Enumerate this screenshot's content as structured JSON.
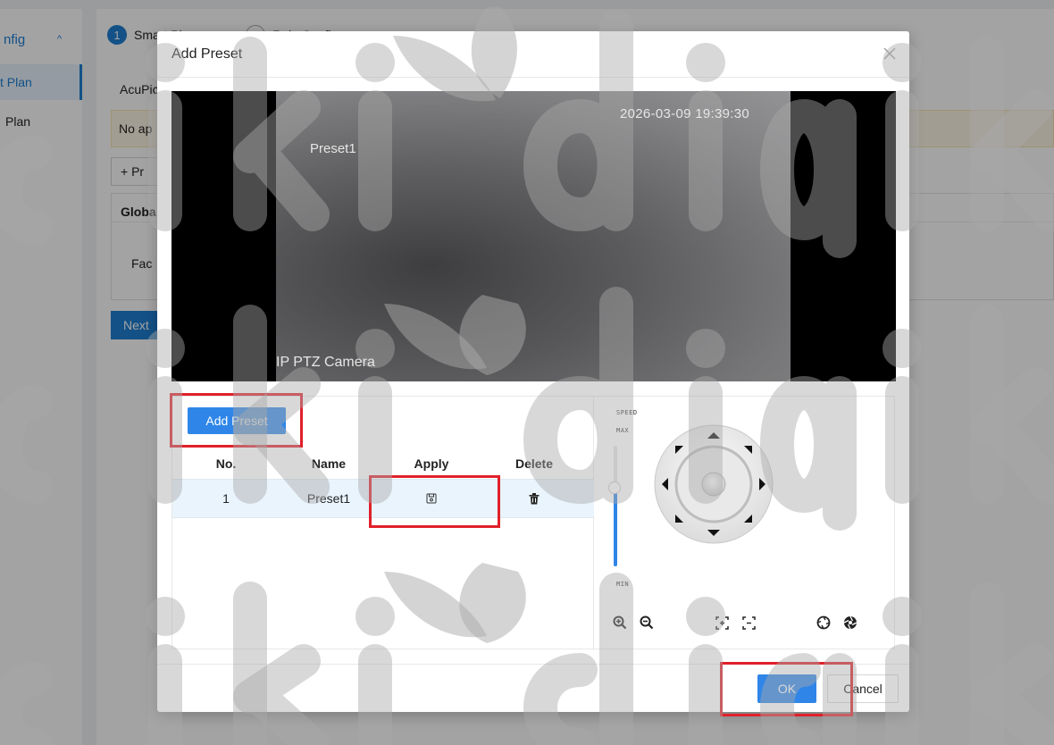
{
  "background": {
    "sidebar": {
      "header": "nfig",
      "items": [
        {
          "label": "t Plan",
          "active": true
        },
        {
          "label": "Plan",
          "active": false
        }
      ]
    },
    "steps": [
      {
        "num": "1",
        "label": "Smart Plan"
      },
      {
        "num": "2",
        "label": "Rule Config"
      }
    ],
    "section_label": "AcuPic",
    "alert_text": "No ap",
    "add_label": "+ Pr",
    "card_header": "Globa",
    "card_row_label": "Fac",
    "next_label": "Next"
  },
  "modal": {
    "title": "Add Preset",
    "close_icon": "close-icon",
    "video": {
      "timestamp": "2026-03-09 19:39:30",
      "preset_name": "Preset1",
      "camera_name": "IP PTZ Camera"
    },
    "add_preset_label": "Add Preset",
    "table": {
      "columns": [
        "No.",
        "Name",
        "Apply",
        "Delete"
      ],
      "rows": [
        {
          "no": "1",
          "name": "Preset1",
          "apply_icon": "save-icon",
          "delete_icon": "trash-icon"
        }
      ]
    },
    "ptz": {
      "speed_label": "SPEED",
      "max_label": "MAX",
      "min_label": "MIN",
      "speed_level": 0.65,
      "tools": [
        "zoom-in-icon",
        "zoom-out-icon",
        "focus-near-icon",
        "focus-far-icon",
        "iris-open-icon",
        "iris-close-icon"
      ]
    },
    "ok_label": "OK",
    "cancel_label": "Cancel"
  },
  "colors": {
    "accent": "#2f86e8",
    "highlight": "#e0202a",
    "watermark": "#a9a9a9"
  }
}
